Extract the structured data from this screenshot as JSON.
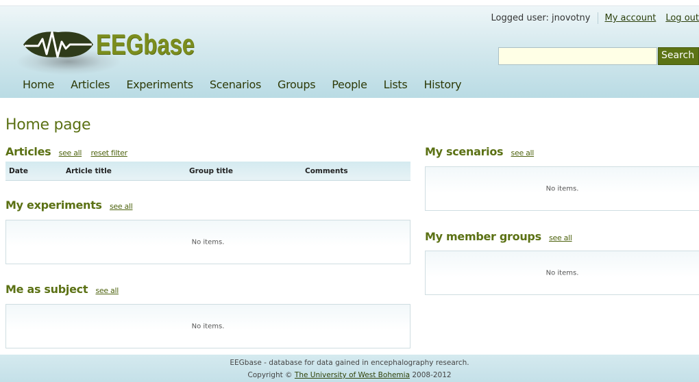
{
  "logo": {
    "text": "EEGbase"
  },
  "user": {
    "label": "Logged user: jnovotny",
    "my_account": "My account",
    "logout": "Log out"
  },
  "search": {
    "value": "",
    "button_label": "Search"
  },
  "nav": {
    "items": [
      "Home",
      "Articles",
      "Experiments",
      "Scenarios",
      "Groups",
      "People",
      "Lists",
      "History"
    ]
  },
  "page_title": "Home page",
  "articles": {
    "title": "Articles",
    "see_all": "see all",
    "reset_filter": "reset filter",
    "columns": [
      "Date",
      "Article title",
      "Group title",
      "Comments"
    ]
  },
  "my_experiments": {
    "title": "My experiments",
    "see_all": "see all",
    "empty": "No items."
  },
  "me_as_subject": {
    "title": "Me as subject",
    "see_all": "see all",
    "empty": "No items."
  },
  "my_scenarios": {
    "title": "My scenarios",
    "see_all": "see all",
    "empty": "No items."
  },
  "my_member_groups": {
    "title": "My member groups",
    "see_all": "see all",
    "empty": "No items."
  },
  "footer": {
    "line1": "EEGbase - database for data gained in encephalography research.",
    "copyright_prefix": "Copyright ©",
    "university": "The University of West Bohemia",
    "years": "2008-2012"
  },
  "colors": {
    "accent_green": "#5b7114",
    "search_button": "#5c7314",
    "header_blue": "#b9dbe4"
  }
}
